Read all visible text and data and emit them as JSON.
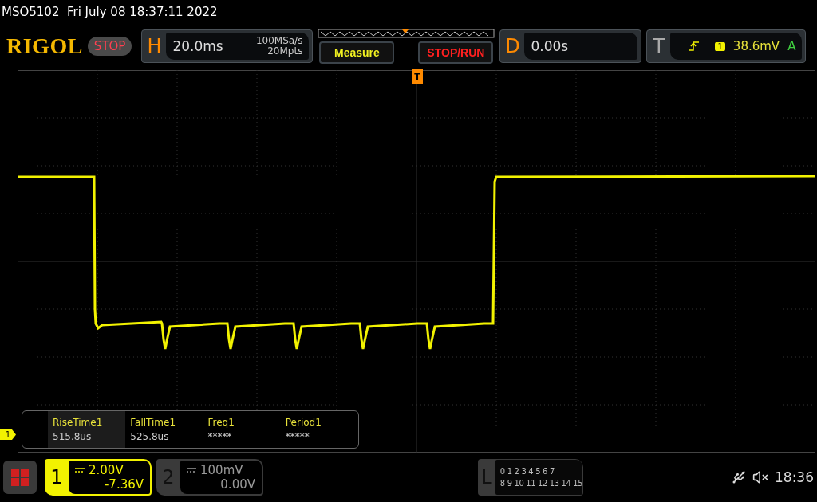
{
  "status_line": "MSO5102  Fri July 08 18:37:11 2022",
  "brand": "RIGOL",
  "run_state": {
    "label": "STOP",
    "kind": "stop"
  },
  "horizontal": {
    "letter": "H",
    "timebase": "20.0ms",
    "sample_rate": "100MSa/s",
    "memory_depth": "20Mpts"
  },
  "buttons": [
    {
      "label": "Measure",
      "kind": "measure"
    },
    {
      "label": "STOP/RUN",
      "kind": "run"
    }
  ],
  "delay": {
    "letter": "D",
    "value": "0.00s"
  },
  "trigger": {
    "letter": "T",
    "channel": "1",
    "level": "38.6mV",
    "mode": "A"
  },
  "trigger_marker": "T",
  "channel_marker": "1",
  "measurements": [
    {
      "name": "RiseTime1",
      "value": "515.8us",
      "selected": true
    },
    {
      "name": "FallTime1",
      "value": "525.8us",
      "selected": false
    },
    {
      "name": "Freq1",
      "value": "*****",
      "selected": false
    },
    {
      "name": "Period1",
      "value": "*****",
      "selected": false
    }
  ],
  "channels": [
    {
      "number": "1",
      "scale": "2.00V",
      "offset": "-7.36V",
      "active": true
    },
    {
      "number": "2",
      "scale": "100mV",
      "offset": "0.00V",
      "active": false
    }
  ],
  "logic": {
    "letter": "L",
    "bits_row_1": [
      "0",
      "1",
      "2",
      "3",
      "4",
      "5",
      "6",
      "7"
    ],
    "bits_row_2": [
      "8",
      "9",
      "10",
      "11",
      "12",
      "13",
      "14",
      "15"
    ]
  },
  "clock": "18:36"
}
